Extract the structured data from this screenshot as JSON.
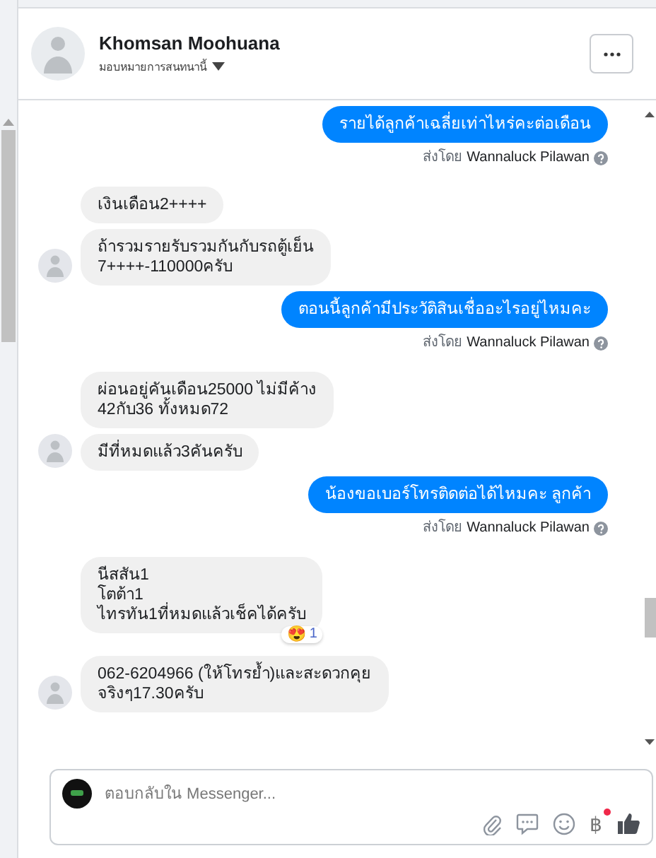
{
  "header": {
    "name": "Khomsan Moohuana",
    "subtitle": "มอบหมายการสนทนานี้"
  },
  "messages": [
    {
      "kind": "outgoing",
      "text": "รายได้ลูกค้าเฉลี่ยเท่าไหร่คะต่อเดือน",
      "sent_by_label": "ส่งโดย",
      "sender": "Wannaluck Pilawan"
    },
    {
      "kind": "incoming",
      "text": "เงินเดือน2++++",
      "avatar": false
    },
    {
      "kind": "incoming",
      "text": "ถ้ารวมรายรับรวมกันกับรถตู้เย็น\n7++++-110000ครับ",
      "avatar": true
    },
    {
      "kind": "outgoing",
      "text": "ตอนนี้ลูกค้ามีประวัติสินเชื่ออะไรอยู่ไหมคะ",
      "sent_by_label": "ส่งโดย",
      "sender": "Wannaluck Pilawan"
    },
    {
      "kind": "incoming",
      "text": "ผ่อนอยู่คันเดือน25000 ไม่มีค้าง\n42กับ36 ทั้งหมด72",
      "avatar": false
    },
    {
      "kind": "incoming",
      "text": "มีที่หมดแล้ว3คันครับ",
      "avatar": true
    },
    {
      "kind": "outgoing",
      "text": "น้องขอเบอร์โทรติดต่อได้ไหมคะ ลูกค้า",
      "sent_by_label": "ส่งโดย",
      "sender": "Wannaluck Pilawan"
    },
    {
      "kind": "incoming",
      "text": "นีสสัน1\nโตต้า1\nไทรทัน1ที่หมดแล้วเช็คได้ครับ",
      "avatar": false,
      "reaction": {
        "emoji": "😍",
        "count": "1"
      }
    },
    {
      "kind": "incoming",
      "text": "062-6204966 (ให้โทรย้ำ)และสะดวกคุย\nจริงๆ17.30ครับ",
      "avatar": true
    }
  ],
  "composer": {
    "placeholder": "ตอบกลับใน Messenger...",
    "currency_symbol": "฿",
    "currency_badge": true
  }
}
